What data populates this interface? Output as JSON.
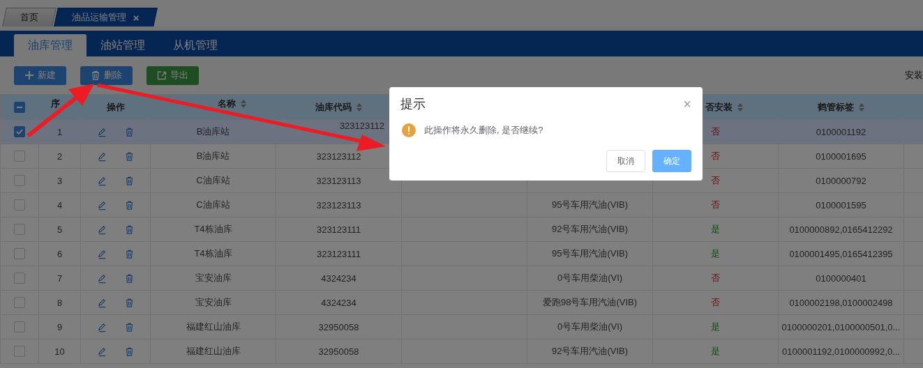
{
  "page_tabs": [
    {
      "label": "首页",
      "selected": false,
      "closable": false
    },
    {
      "label": "油品运输管理",
      "selected": true,
      "closable": true,
      "close_icon": "×"
    }
  ],
  "sub_tabs": [
    {
      "label": "油库管理",
      "selected": true
    },
    {
      "label": "油站管理",
      "selected": false
    },
    {
      "label": "从机管理",
      "selected": false
    }
  ],
  "toolbar": {
    "buttons": [
      {
        "kind": "add",
        "label": "新建"
      },
      {
        "kind": "delete",
        "label": "删除"
      },
      {
        "kind": "export",
        "label": "导出"
      }
    ],
    "filter_label": "安装"
  },
  "table": {
    "header_checkbox": {
      "indeterminate": true
    },
    "columns": [
      {},
      {
        "label": "序"
      },
      {
        "label": "操作"
      },
      {
        "label": "名称",
        "sortable": true
      },
      {
        "label": "油库代码",
        "sortable": true
      },
      {},
      {},
      {
        "label": "否安装",
        "sortable": true
      },
      {
        "label": "鹤管标签",
        "sortable": true
      },
      {}
    ],
    "rows": [
      {
        "selected": true,
        "checked": true,
        "index": "1",
        "name": "B油库站",
        "code": "323123112",
        "installed": false,
        "installed_label": "否",
        "tags": "0100001192"
      },
      {
        "selected": false,
        "checked": false,
        "index": "2",
        "name": "B油库站",
        "code": "323123112",
        "installed": false,
        "installed_label": "否",
        "tags": "0100001695"
      },
      {
        "selected": false,
        "checked": false,
        "index": "3",
        "name": "C油库站",
        "code": "323123113",
        "installed": false,
        "installed_label": "否",
        "tags": "0100000792"
      },
      {
        "selected": false,
        "checked": false,
        "index": "4",
        "name": "C油库站",
        "code": "323123113",
        "oil": "95号车用汽油(VIB)",
        "installed": false,
        "installed_label": "否",
        "tags": "0100001595"
      },
      {
        "selected": false,
        "checked": false,
        "index": "5",
        "name": "T4栋油库",
        "code": "323123111",
        "oil": "92号车用汽油(VIB)",
        "installed": true,
        "installed_label": "是",
        "tags": "0100000892,0165412292"
      },
      {
        "selected": false,
        "checked": false,
        "index": "6",
        "name": "T4栋油库",
        "code": "323123111",
        "oil": "95号车用汽油(VIB)",
        "installed": true,
        "installed_label": "是",
        "tags": "0100001495,0165412395"
      },
      {
        "selected": false,
        "checked": false,
        "index": "7",
        "name": "宝安油库",
        "code": "4324234",
        "oil": "0号车用柴油(VI)",
        "installed": false,
        "installed_label": "否",
        "tags": "0100000401"
      },
      {
        "selected": false,
        "checked": false,
        "index": "8",
        "name": "宝安油库",
        "code": "4324234",
        "oil": "爱跑98号车用汽油(VIB)",
        "installed": false,
        "installed_label": "否",
        "tags": "0100002198,0100002498"
      },
      {
        "selected": false,
        "checked": false,
        "index": "9",
        "name": "福建红山油库",
        "code": "32950058",
        "oil": "0号车用柴油(VI)",
        "installed": true,
        "installed_label": "是",
        "tags": "0100000201,0100000501,0..."
      },
      {
        "selected": false,
        "checked": false,
        "index": "10",
        "name": "福建红山油库",
        "code": "32950058",
        "oil": "92号车用汽油(VIB)",
        "installed": true,
        "installed_label": "是",
        "tags": "0100001192,0100000992,0..."
      }
    ]
  },
  "dialog": {
    "title": "提示",
    "close_icon": "×",
    "message": "此操作将永久删除, 是否继续?",
    "buttons": [
      {
        "kind": "secondary",
        "label": "取消"
      },
      {
        "kind": "primary",
        "label": "确定"
      }
    ]
  }
}
